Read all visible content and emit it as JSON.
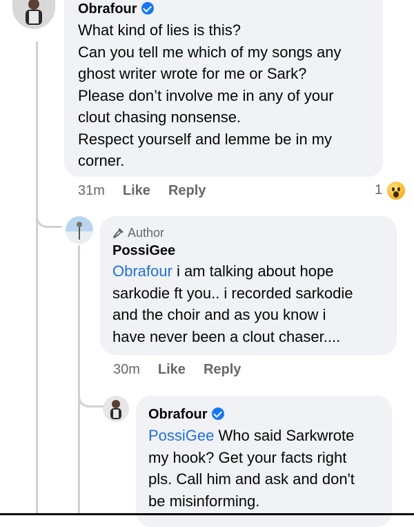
{
  "comments": [
    {
      "author": "Obrafour",
      "verified": true,
      "lines": [
        "What kind of lies is this?",
        "Can you tell me which of my songs any",
        "ghost writer wrote for me or Sark?",
        "Please don’t involve me in any of your",
        "clout chasing nonsense.",
        "Respect yourself and lemme be in my",
        "corner."
      ],
      "time": "31m",
      "like_label": "Like",
      "reply_label": "Reply",
      "reaction_count": "1",
      "reaction_icon": "wow-reaction-icon"
    },
    {
      "author_badge": "Author",
      "author": "PossiGee",
      "mention": "Obrafour",
      "lines": [
        " i am talking about hope",
        "sarkodie ft you.. i recorded sarkodie",
        "and the choir and as you know i",
        "have never been a clout chaser...."
      ],
      "time": "30m",
      "like_label": "Like",
      "reply_label": "Reply"
    },
    {
      "author": "Obrafour",
      "verified": true,
      "mention": "PossiGee",
      "lines": [
        " Who said Sarkwrote",
        "my hook? Get your facts right",
        "pls. Call him and ask and don't",
        "be misinforming."
      ]
    }
  ],
  "colors": {
    "bubble": "#f0f2f5",
    "mention": "#216fdb",
    "meta": "#65676b",
    "verified": "#1877f2"
  }
}
